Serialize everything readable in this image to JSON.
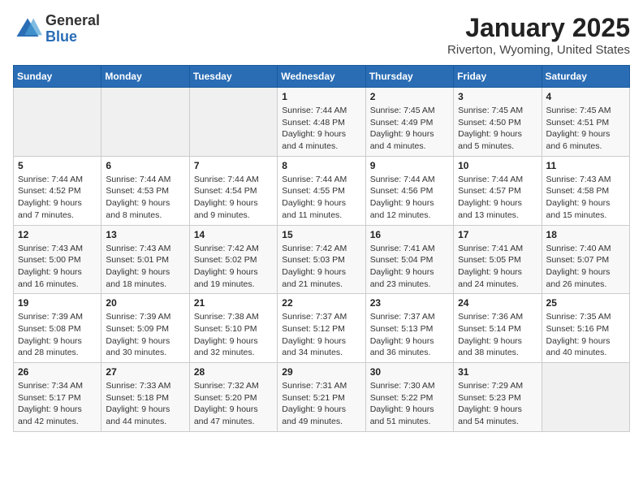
{
  "logo": {
    "general": "General",
    "blue": "Blue"
  },
  "title": "January 2025",
  "subtitle": "Riverton, Wyoming, United States",
  "days_header": [
    "Sunday",
    "Monday",
    "Tuesday",
    "Wednesday",
    "Thursday",
    "Friday",
    "Saturday"
  ],
  "weeks": [
    [
      {
        "day": "",
        "info": ""
      },
      {
        "day": "",
        "info": ""
      },
      {
        "day": "",
        "info": ""
      },
      {
        "day": "1",
        "info": "Sunrise: 7:44 AM\nSunset: 4:48 PM\nDaylight: 9 hours\nand 4 minutes."
      },
      {
        "day": "2",
        "info": "Sunrise: 7:45 AM\nSunset: 4:49 PM\nDaylight: 9 hours\nand 4 minutes."
      },
      {
        "day": "3",
        "info": "Sunrise: 7:45 AM\nSunset: 4:50 PM\nDaylight: 9 hours\nand 5 minutes."
      },
      {
        "day": "4",
        "info": "Sunrise: 7:45 AM\nSunset: 4:51 PM\nDaylight: 9 hours\nand 6 minutes."
      }
    ],
    [
      {
        "day": "5",
        "info": "Sunrise: 7:44 AM\nSunset: 4:52 PM\nDaylight: 9 hours\nand 7 minutes."
      },
      {
        "day": "6",
        "info": "Sunrise: 7:44 AM\nSunset: 4:53 PM\nDaylight: 9 hours\nand 8 minutes."
      },
      {
        "day": "7",
        "info": "Sunrise: 7:44 AM\nSunset: 4:54 PM\nDaylight: 9 hours\nand 9 minutes."
      },
      {
        "day": "8",
        "info": "Sunrise: 7:44 AM\nSunset: 4:55 PM\nDaylight: 9 hours\nand 11 minutes."
      },
      {
        "day": "9",
        "info": "Sunrise: 7:44 AM\nSunset: 4:56 PM\nDaylight: 9 hours\nand 12 minutes."
      },
      {
        "day": "10",
        "info": "Sunrise: 7:44 AM\nSunset: 4:57 PM\nDaylight: 9 hours\nand 13 minutes."
      },
      {
        "day": "11",
        "info": "Sunrise: 7:43 AM\nSunset: 4:58 PM\nDaylight: 9 hours\nand 15 minutes."
      }
    ],
    [
      {
        "day": "12",
        "info": "Sunrise: 7:43 AM\nSunset: 5:00 PM\nDaylight: 9 hours\nand 16 minutes."
      },
      {
        "day": "13",
        "info": "Sunrise: 7:43 AM\nSunset: 5:01 PM\nDaylight: 9 hours\nand 18 minutes."
      },
      {
        "day": "14",
        "info": "Sunrise: 7:42 AM\nSunset: 5:02 PM\nDaylight: 9 hours\nand 19 minutes."
      },
      {
        "day": "15",
        "info": "Sunrise: 7:42 AM\nSunset: 5:03 PM\nDaylight: 9 hours\nand 21 minutes."
      },
      {
        "day": "16",
        "info": "Sunrise: 7:41 AM\nSunset: 5:04 PM\nDaylight: 9 hours\nand 23 minutes."
      },
      {
        "day": "17",
        "info": "Sunrise: 7:41 AM\nSunset: 5:05 PM\nDaylight: 9 hours\nand 24 minutes."
      },
      {
        "day": "18",
        "info": "Sunrise: 7:40 AM\nSunset: 5:07 PM\nDaylight: 9 hours\nand 26 minutes."
      }
    ],
    [
      {
        "day": "19",
        "info": "Sunrise: 7:39 AM\nSunset: 5:08 PM\nDaylight: 9 hours\nand 28 minutes."
      },
      {
        "day": "20",
        "info": "Sunrise: 7:39 AM\nSunset: 5:09 PM\nDaylight: 9 hours\nand 30 minutes."
      },
      {
        "day": "21",
        "info": "Sunrise: 7:38 AM\nSunset: 5:10 PM\nDaylight: 9 hours\nand 32 minutes."
      },
      {
        "day": "22",
        "info": "Sunrise: 7:37 AM\nSunset: 5:12 PM\nDaylight: 9 hours\nand 34 minutes."
      },
      {
        "day": "23",
        "info": "Sunrise: 7:37 AM\nSunset: 5:13 PM\nDaylight: 9 hours\nand 36 minutes."
      },
      {
        "day": "24",
        "info": "Sunrise: 7:36 AM\nSunset: 5:14 PM\nDaylight: 9 hours\nand 38 minutes."
      },
      {
        "day": "25",
        "info": "Sunrise: 7:35 AM\nSunset: 5:16 PM\nDaylight: 9 hours\nand 40 minutes."
      }
    ],
    [
      {
        "day": "26",
        "info": "Sunrise: 7:34 AM\nSunset: 5:17 PM\nDaylight: 9 hours\nand 42 minutes."
      },
      {
        "day": "27",
        "info": "Sunrise: 7:33 AM\nSunset: 5:18 PM\nDaylight: 9 hours\nand 44 minutes."
      },
      {
        "day": "28",
        "info": "Sunrise: 7:32 AM\nSunset: 5:20 PM\nDaylight: 9 hours\nand 47 minutes."
      },
      {
        "day": "29",
        "info": "Sunrise: 7:31 AM\nSunset: 5:21 PM\nDaylight: 9 hours\nand 49 minutes."
      },
      {
        "day": "30",
        "info": "Sunrise: 7:30 AM\nSunset: 5:22 PM\nDaylight: 9 hours\nand 51 minutes."
      },
      {
        "day": "31",
        "info": "Sunrise: 7:29 AM\nSunset: 5:23 PM\nDaylight: 9 hours\nand 54 minutes."
      },
      {
        "day": "",
        "info": ""
      }
    ]
  ]
}
